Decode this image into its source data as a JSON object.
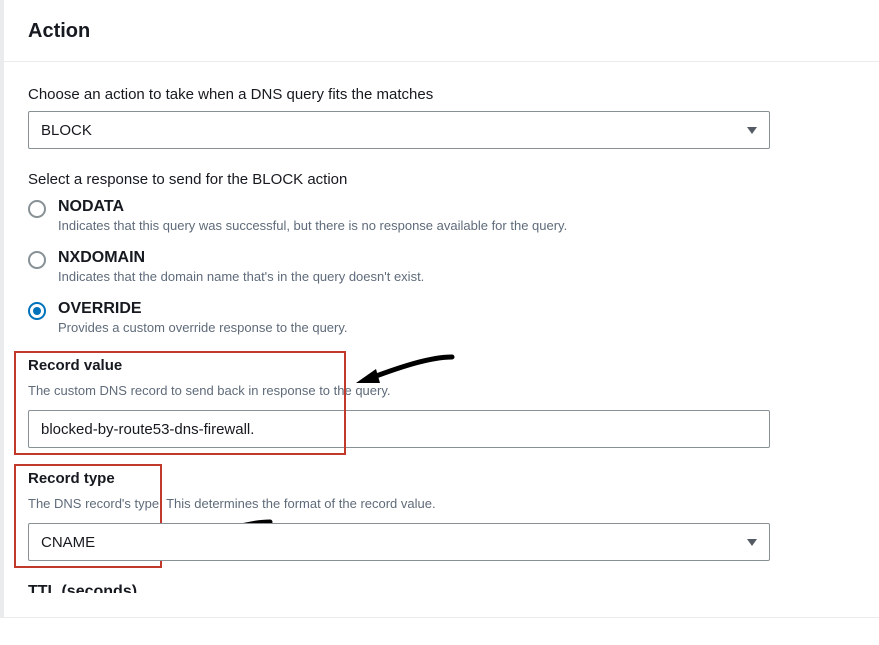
{
  "header": {
    "title": "Action"
  },
  "action_select": {
    "label": "Choose an action to take when a DNS query fits the matches",
    "value": "BLOCK"
  },
  "response_section": {
    "label": "Select a response to send for the BLOCK action",
    "options": [
      {
        "key": "nodata",
        "label": "NODATA",
        "desc": "Indicates that this query was successful, but there is no response available for the query.",
        "selected": false
      },
      {
        "key": "nxdomain",
        "label": "NXDOMAIN",
        "desc": "Indicates that the domain name that's in the query doesn't exist.",
        "selected": false
      },
      {
        "key": "override",
        "label": "OVERRIDE",
        "desc": "Provides a custom override response to the query.",
        "selected": true
      }
    ]
  },
  "record_value": {
    "label": "Record value",
    "desc": "The custom DNS record to send back in response to the query.",
    "value": "blocked-by-route53-dns-firewall."
  },
  "record_type": {
    "label": "Record type",
    "desc": "The DNS record's type. This determines the format of the record value.",
    "value": "CNAME"
  },
  "ttl": {
    "label_partial": "TTL (seconds)"
  },
  "annotations": {
    "highlight_color": "#c0392b"
  }
}
